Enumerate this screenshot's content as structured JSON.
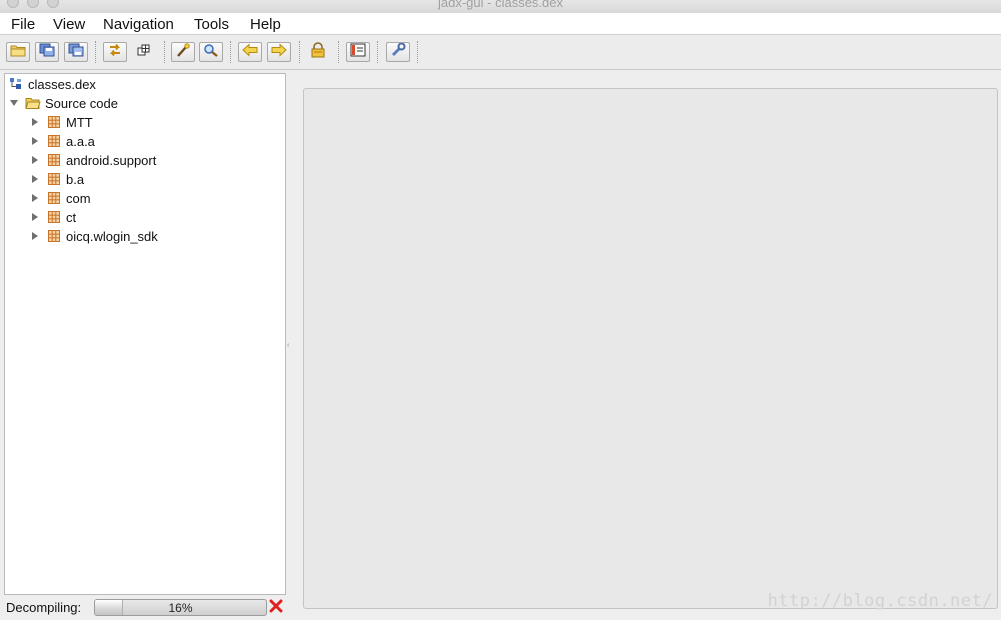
{
  "window": {
    "title": "jadx-gui - classes.dex"
  },
  "menu": {
    "items": [
      {
        "label": "File"
      },
      {
        "label": "View"
      },
      {
        "label": "Navigation"
      },
      {
        "label": "Tools"
      },
      {
        "label": "Help"
      }
    ]
  },
  "toolbar": {
    "buttons": [
      {
        "icon": "open-folder-icon"
      },
      {
        "icon": "save-all-icon"
      },
      {
        "icon": "export-icon"
      },
      {
        "icon": "sync-icon"
      },
      {
        "icon": "flatten-packages-icon"
      },
      {
        "icon": "wand-search-icon"
      },
      {
        "icon": "magnifier-icon"
      },
      {
        "icon": "back-arrow-icon"
      },
      {
        "icon": "forward-arrow-icon"
      },
      {
        "icon": "lock-icon"
      },
      {
        "icon": "log-icon"
      },
      {
        "icon": "wrench-icon"
      }
    ]
  },
  "tree": {
    "root": {
      "label": "classes.dex",
      "icon": "dex-file-icon"
    },
    "source": {
      "label": "Source code",
      "icon": "open-folder-icon",
      "expanded": true
    },
    "packages": [
      {
        "label": "MTT",
        "icon": "package-icon"
      },
      {
        "label": "a.a.a",
        "icon": "package-icon"
      },
      {
        "label": "android.support",
        "icon": "package-icon"
      },
      {
        "label": "b.a",
        "icon": "package-icon"
      },
      {
        "label": "com",
        "icon": "package-icon"
      },
      {
        "label": "ct",
        "icon": "package-icon"
      },
      {
        "label": "oicq.wlogin_sdk",
        "icon": "package-icon"
      }
    ]
  },
  "status": {
    "label": "Decompiling:",
    "progress_text": "16%",
    "progress_fraction": 0.16
  },
  "watermark": "http://blog.csdn.net/",
  "colors": {
    "package_icon": "#c8732a",
    "cancel_x": "#e02020",
    "folder": "#e8b84a"
  }
}
